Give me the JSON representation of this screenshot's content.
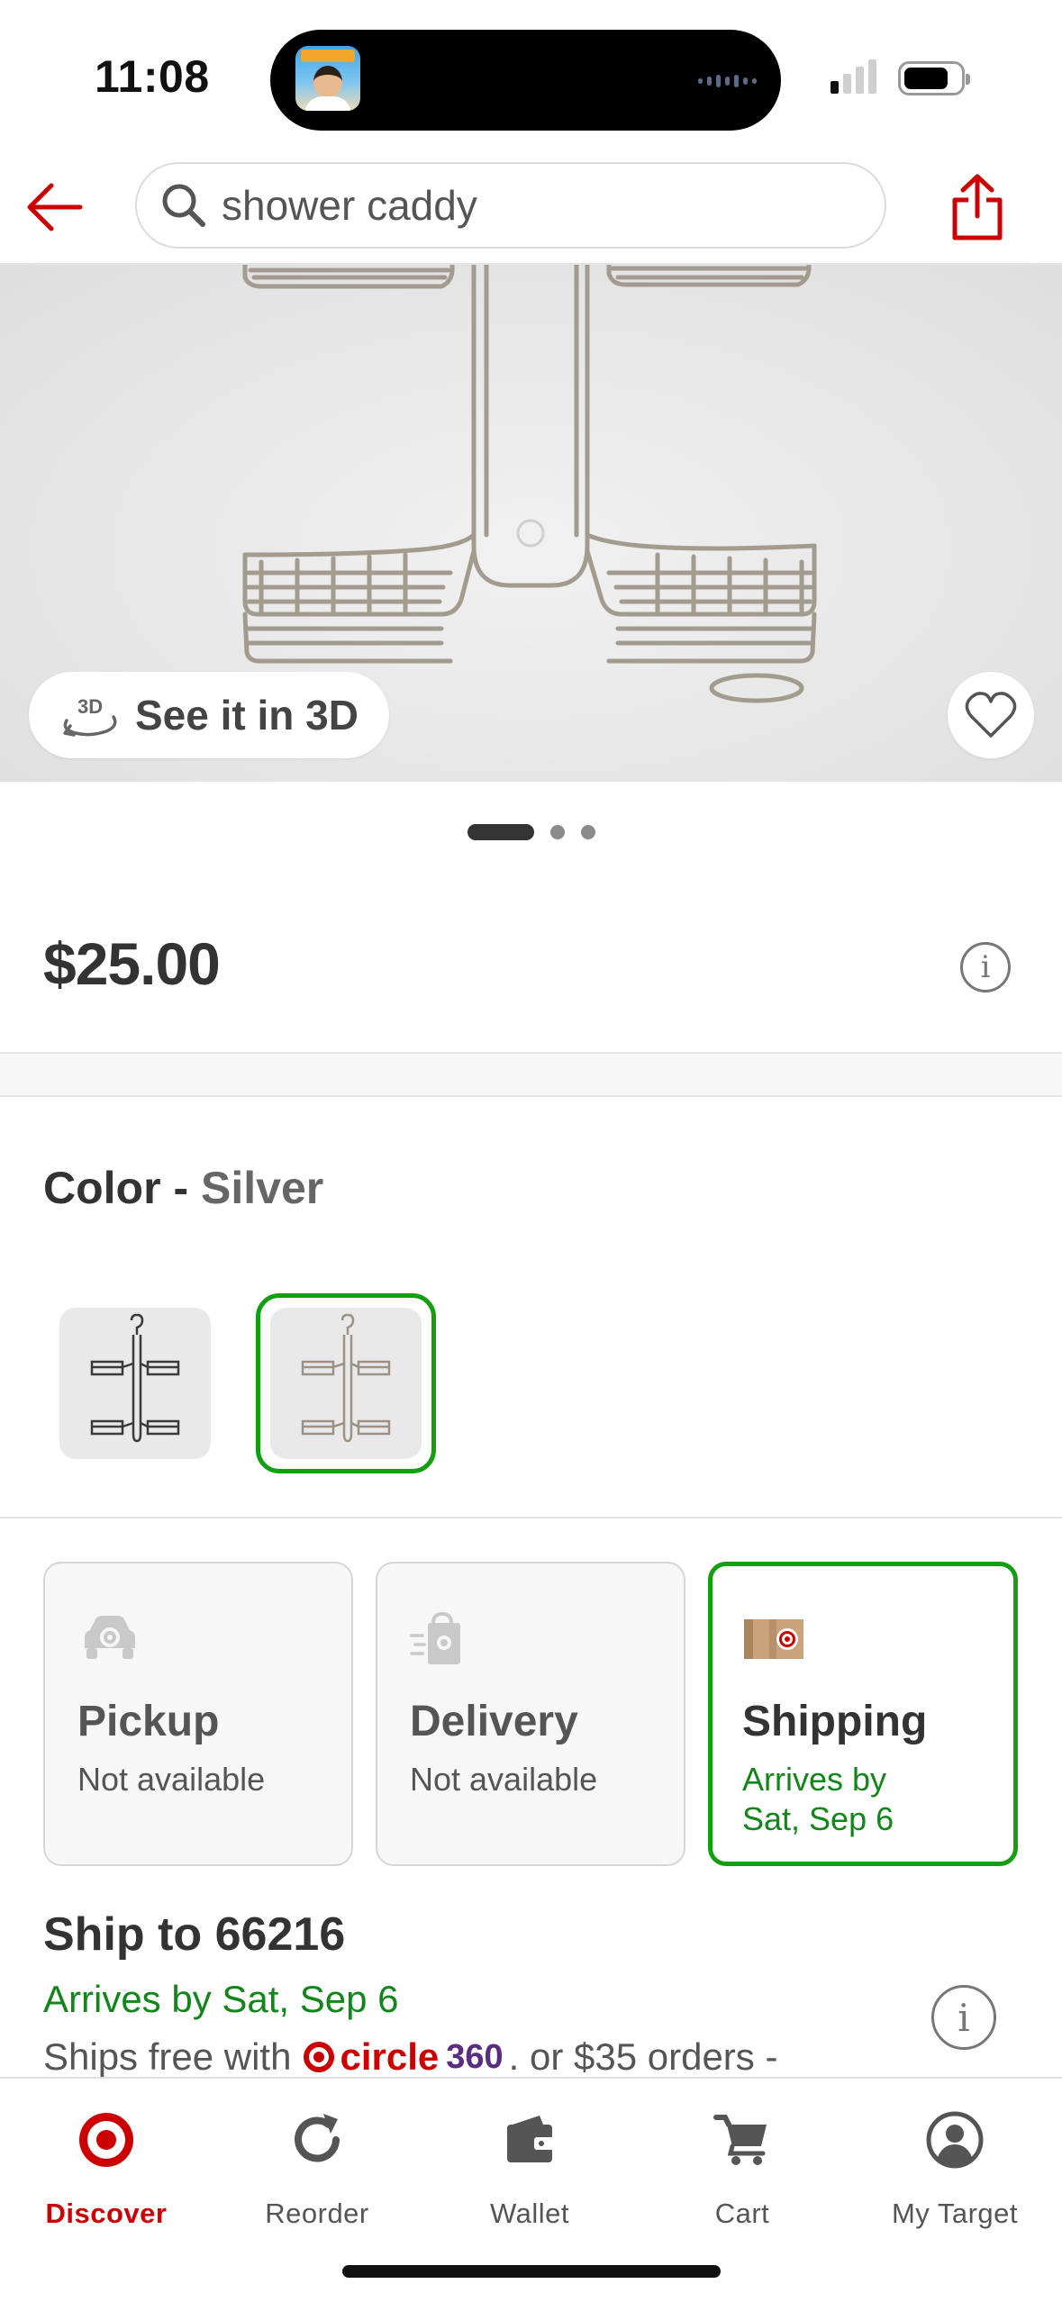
{
  "status_bar": {
    "time": "11:08"
  },
  "header": {
    "search": {
      "value": "shower caddy"
    }
  },
  "product": {
    "see_in_3d_label": "See it in 3D",
    "image_pages": 3,
    "active_image_page": 1,
    "price": "$25.00"
  },
  "color": {
    "label": "Color",
    "separator": "-",
    "selected": "Silver",
    "swatches": [
      {
        "name": "Black",
        "selected": false
      },
      {
        "name": "Silver",
        "selected": true
      }
    ]
  },
  "fulfillment": {
    "pickup": {
      "title": "Pickup",
      "subtitle": "Not available"
    },
    "delivery": {
      "title": "Delivery",
      "subtitle": "Not available"
    },
    "shipping": {
      "title": "Shipping",
      "subtitle_line1": "Arrives by",
      "subtitle_line2": "Sat, Sep 6",
      "selected": true
    }
  },
  "ship_to": {
    "title": "Ship to 66216",
    "arrives": "Arrives by Sat, Sep 6",
    "free_prefix": "Ships free with",
    "circle_word": "circle",
    "circle_number": "360",
    "free_suffix": ". or $35 orders -"
  },
  "tabbar": {
    "tabs": [
      {
        "label": "Discover",
        "icon": "target-bullseye-icon",
        "active": true
      },
      {
        "label": "Reorder",
        "icon": "reorder-icon",
        "active": false
      },
      {
        "label": "Wallet",
        "icon": "wallet-icon",
        "active": false
      },
      {
        "label": "Cart",
        "icon": "cart-icon",
        "active": false
      },
      {
        "label": "My Target",
        "icon": "account-icon",
        "active": false
      }
    ]
  },
  "colors": {
    "brand_red": "#cc0000",
    "selected_green": "#12a012",
    "arrival_green": "#12861a",
    "circle360_purple": "#5a2d82"
  }
}
